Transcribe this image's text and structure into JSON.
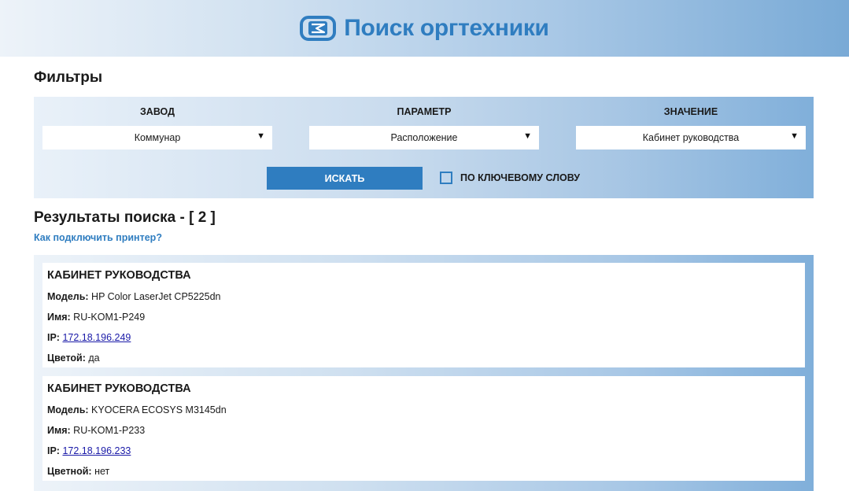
{
  "header": {
    "title": "Поиск оргтехники",
    "logo_icon": "printer-logo-icon",
    "accent_color": "#2f7dc0"
  },
  "filters": {
    "title": "Фильтры",
    "columns": [
      {
        "label": "ЗАВОД",
        "selected": "Коммунар"
      },
      {
        "label": "ПАРАМЕТР",
        "selected": "Расположение"
      },
      {
        "label": "ЗНАЧЕНИЕ",
        "selected": "Кабинет руководства"
      }
    ],
    "dropdown_arrow": "▼",
    "search_label": "ИСКАТЬ",
    "keyword_label": "ПО КЛЮЧЕВОМУ СЛОВУ",
    "keyword_checked": false
  },
  "results": {
    "title": "Результаты поиска - [ 2 ]",
    "help_link": "Как подключить принтер?",
    "items": [
      {
        "location": "КАБИНЕТ РУКОВОДСТВА",
        "model_label": "Модель:",
        "model": "HP Color LaserJet CP5225dn",
        "name_label": "Имя:",
        "name": "RU-KOM1-P249",
        "ip_label": "IP:",
        "ip": "172.18.196.249",
        "color_label": "Цветой:",
        "color": "да"
      },
      {
        "location": "КАБИНЕТ РУКОВОДСТВА",
        "model_label": "Модель:",
        "model": "KYOCERA ECOSYS M3145dn",
        "name_label": "Имя:",
        "name": "RU-KOM1-P233",
        "ip_label": "IP:",
        "ip": "172.18.196.233",
        "color_label": "Цветной:",
        "color": "нет"
      }
    ]
  }
}
